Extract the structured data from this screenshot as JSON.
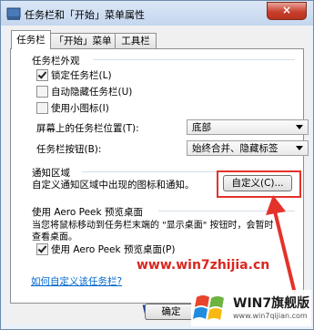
{
  "window": {
    "title": "任务栏和「开始」菜单属性",
    "close_label": "×"
  },
  "tabs": [
    {
      "label": "任务栏",
      "active": true
    },
    {
      "label": "「开始」菜单",
      "active": false
    },
    {
      "label": "工具栏",
      "active": false
    }
  ],
  "appearance": {
    "heading": "任务栏外观",
    "lock": {
      "label": "锁定任务栏(L)",
      "checked": true
    },
    "autohide": {
      "label": "自动隐藏任务栏(U)",
      "checked": false
    },
    "small_icons": {
      "label": "使用小图标(I)",
      "checked": false
    },
    "location_label": "屏幕上的任务栏位置(T):",
    "location_value": "底部",
    "buttons_label": "任务栏按钮(B):",
    "buttons_value": "始终合并、隐藏标签"
  },
  "notification": {
    "heading": "通知区域",
    "description": "自定义通知区域中出现的图标和通知。",
    "customize_button": "自定义(C)..."
  },
  "aero": {
    "heading": "使用 Aero Peek 预览桌面",
    "description_line1": "当您将鼠标移动到任务栏末端的 \"显示桌面\" 按钮时，会暂时",
    "description_line2": "查看桌面。",
    "checkbox_label": "使用 Aero Peek 预览桌面(P)",
    "checked": true
  },
  "link": "如何自定义该任务栏?",
  "footer": {
    "ok": "确定"
  },
  "watermark": {
    "url": "www.win7zhijia.cn",
    "badge_title": "WIN7旗舰版",
    "badge_url": "www.win7qijian.com",
    "wi_text": "Wi"
  },
  "colors": {
    "highlight": "#e3322a",
    "link": "#0066cc"
  }
}
